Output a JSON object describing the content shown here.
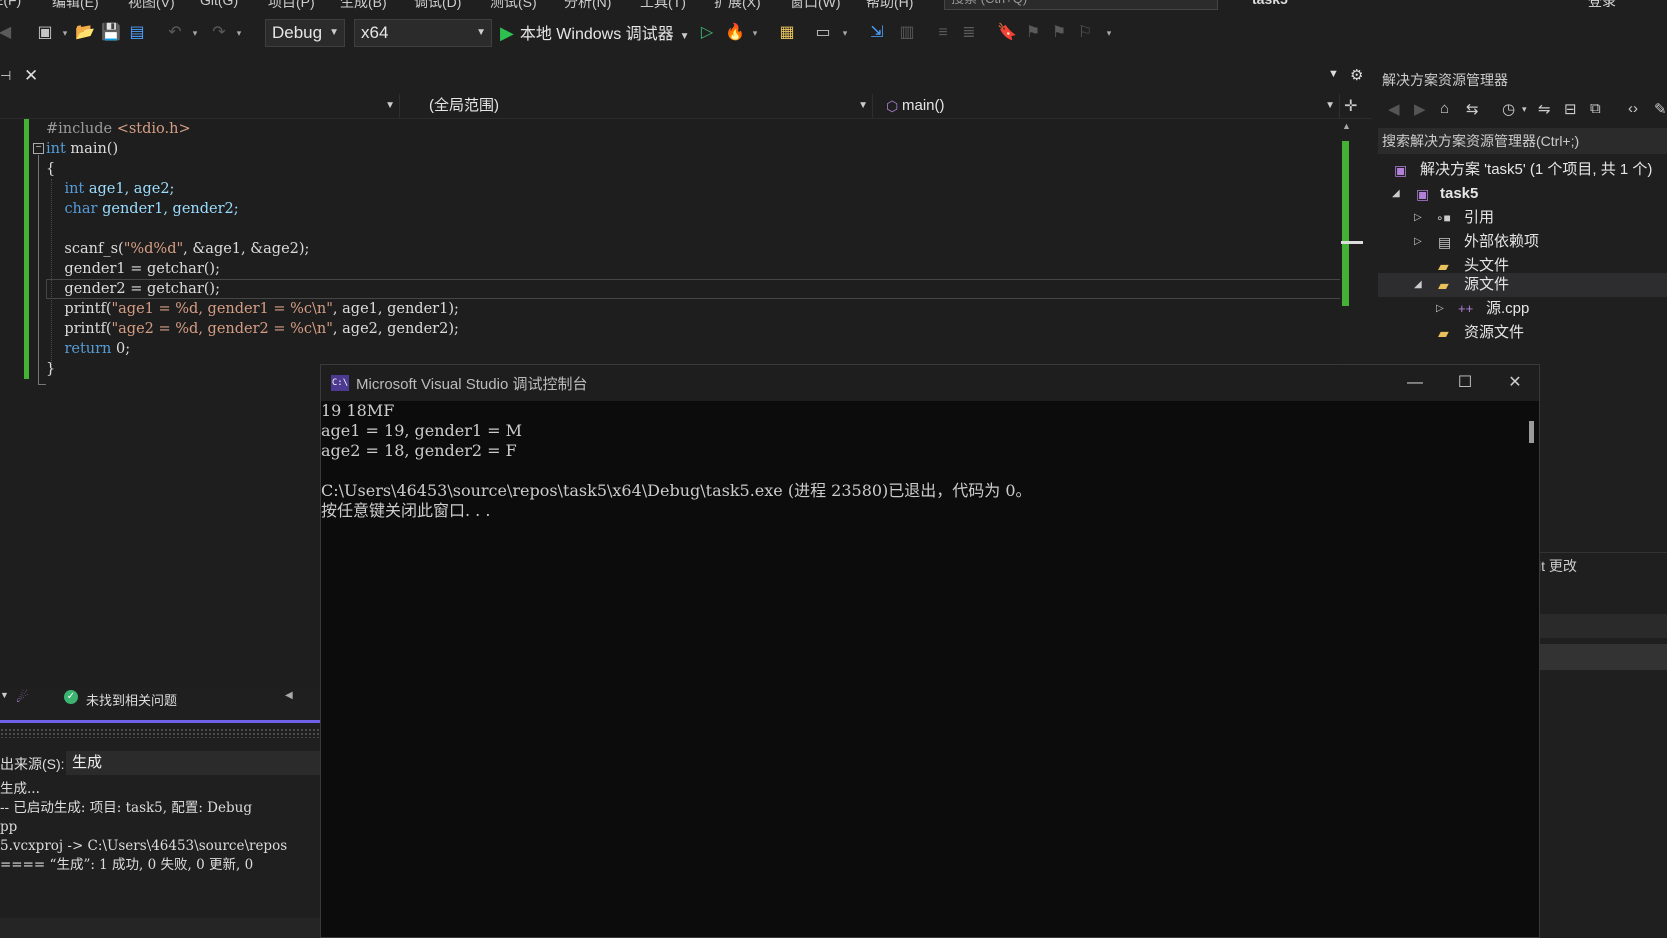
{
  "menubar": {
    "items": [
      "E(F)",
      "编辑(E)",
      "视图(V)",
      "Git(G)",
      "项目(P)",
      "生成(B)",
      "调试(D)",
      "测试(S)",
      "分析(N)",
      "工具(T)",
      "扩展(X)",
      "窗口(W)",
      "帮助(H)"
    ],
    "search_placeholder": "搜索 (Ctrl+Q)",
    "title": "task5",
    "login": "登录"
  },
  "toolbar": {
    "config": "Debug",
    "platform": "x64",
    "debugger": "本地 Windows 调试器"
  },
  "navbar": {
    "scope": "(全局范围)",
    "function": "main()"
  },
  "code": {
    "lines": [
      [
        {
          "t": "#include ",
          "c": "pp"
        },
        {
          "t": "<stdio.h>",
          "c": "inc"
        }
      ],
      [
        {
          "t": "int",
          "c": "kw"
        },
        {
          "t": " main()",
          "c": ""
        }
      ],
      [
        {
          "t": "{",
          "c": ""
        }
      ],
      [
        {
          "t": "    ",
          "c": ""
        },
        {
          "t": "int",
          "c": "kw"
        },
        {
          "t": " age1, age2;",
          "c": "var"
        }
      ],
      [
        {
          "t": "    ",
          "c": ""
        },
        {
          "t": "char",
          "c": "kw"
        },
        {
          "t": " gender1, gender2;",
          "c": "var"
        }
      ],
      [
        {
          "t": "",
          "c": ""
        }
      ],
      [
        {
          "t": "    scanf_s(",
          "c": ""
        },
        {
          "t": "\"%d%d\"",
          "c": "str"
        },
        {
          "t": ", &age1, &age2);",
          "c": ""
        }
      ],
      [
        {
          "t": "    gender1 = getchar();",
          "c": ""
        }
      ],
      [
        {
          "t": "    gender2 = getchar();",
          "c": ""
        }
      ],
      [
        {
          "t": "    printf(",
          "c": ""
        },
        {
          "t": "\"age1 = %d, gender1 = %c\\n\"",
          "c": "str"
        },
        {
          "t": ", age1, gender1);",
          "c": ""
        }
      ],
      [
        {
          "t": "    printf(",
          "c": ""
        },
        {
          "t": "\"age2 = %d, gender2 = %c\\n\"",
          "c": "str"
        },
        {
          "t": ", age2, gender2);",
          "c": ""
        }
      ],
      [
        {
          "t": "    ",
          "c": ""
        },
        {
          "t": "return",
          "c": "kw"
        },
        {
          "t": " 0;",
          "c": ""
        }
      ],
      [
        {
          "t": "}",
          "c": ""
        }
      ]
    ]
  },
  "status": {
    "issues": "未找到相关问题"
  },
  "output": {
    "source_label": "出来源(S):",
    "source_value": "生成",
    "lines": [
      "生成...",
      "-- 已启动生成: 项目: task5, 配置: Debug",
      "pp",
      "5.vcxproj -> C:\\Users\\46453\\source\\repos",
      "==== “生成”: 1 成功, 0 失败, 0 更新, 0"
    ]
  },
  "solution_explorer": {
    "title": "解决方案资源管理器",
    "search": "搜索解决方案资源管理器(Ctrl+;)",
    "solution": "解决方案 'task5' (1 个项目, 共 1 个)",
    "project": "task5",
    "references": "引用",
    "external_deps": "外部依赖项",
    "header_files": "头文件",
    "source_files": "源文件",
    "source_cpp": "源.cpp",
    "resource_files": "资源文件",
    "lower_text": "it 更改"
  },
  "console": {
    "title": "Microsoft Visual Studio 调试控制台",
    "icon_text": "C:\\",
    "lines": [
      "19 18MF",
      "age1 = 19, gender1 = M",
      "age2 = 18, gender2 = F",
      "",
      "C:\\Users\\46453\\source\\repos\\task5\\x64\\Debug\\task5.exe (进程 23580)已退出，代码为 0。",
      "按任意键关闭此窗口. . ."
    ]
  }
}
